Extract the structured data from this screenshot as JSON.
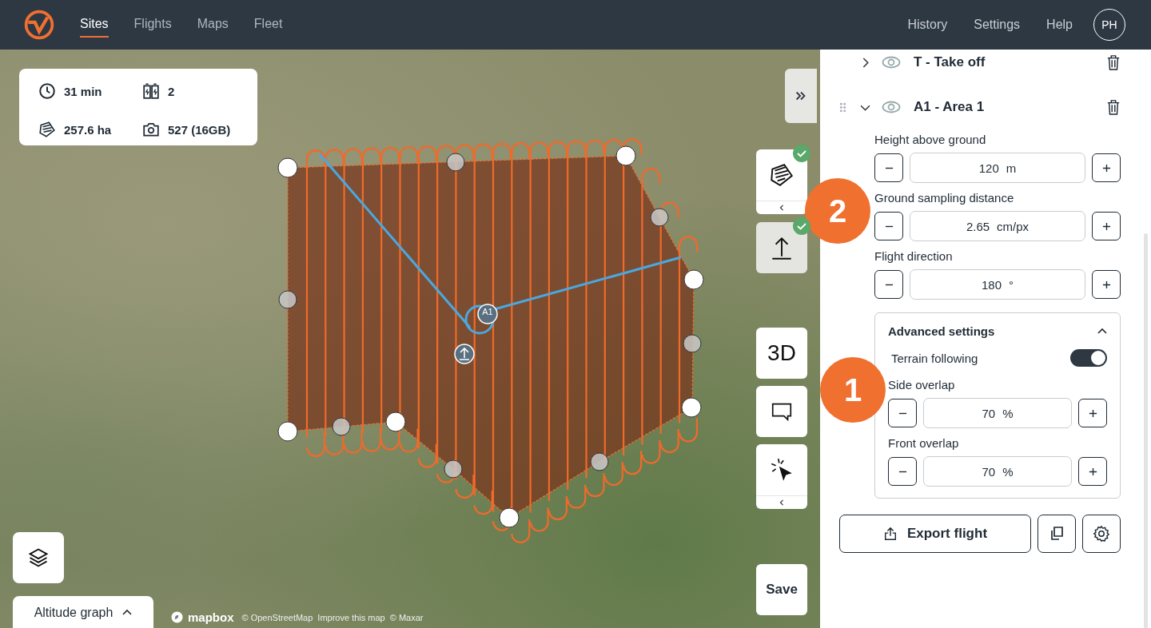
{
  "header": {
    "nav": [
      {
        "label": "Sites",
        "selected": true
      },
      {
        "label": "Flights",
        "selected": false
      },
      {
        "label": "Maps",
        "selected": false
      },
      {
        "label": "Fleet",
        "selected": false
      }
    ],
    "links": [
      "History",
      "Settings",
      "Help"
    ],
    "avatar": "PH"
  },
  "stats": [
    {
      "kind": "time",
      "text": "31 min"
    },
    {
      "kind": "battery",
      "text": "2"
    },
    {
      "kind": "area",
      "text": "257.6 ha"
    },
    {
      "kind": "photos",
      "text": "527 (16GB)"
    }
  ],
  "map": {
    "area_marker": "A1",
    "attribution": [
      "© OpenStreetMap",
      "Improve this map",
      "© Maxar"
    ],
    "logo": "mapbox"
  },
  "plan_tools": [
    {
      "kind": "area",
      "done": true,
      "disabled": false,
      "expander": true
    },
    {
      "kind": "takeoff",
      "done": true,
      "disabled": true,
      "expander": false
    }
  ],
  "view_tools": [
    {
      "kind": "label",
      "text": "3D",
      "expander": false
    },
    {
      "kind": "comment",
      "expander": false
    },
    {
      "kind": "select",
      "expander": true
    }
  ],
  "save_button": "Save",
  "altitude_graph": {
    "label": "Altitude graph",
    "expanded": false
  },
  "sidebar": {
    "items": [
      {
        "label": "T - Take off",
        "expanded": false
      },
      {
        "label": "A1 - Area 1",
        "expanded": true,
        "fields": [
          {
            "label": "Height above ground",
            "value": "120",
            "unit": "m"
          },
          {
            "label": "Ground sampling distance",
            "value": "2.65",
            "unit": "cm/px"
          },
          {
            "label": "Flight direction",
            "value": "180",
            "unit": "°"
          }
        ],
        "advanced": {
          "title": "Advanced settings",
          "expanded": true,
          "toggle": {
            "label": "Terrain following",
            "on": true
          },
          "fields": [
            {
              "label": "Side overlap",
              "value": "70",
              "unit": "%"
            },
            {
              "label": "Front overlap",
              "value": "70",
              "unit": "%"
            }
          ]
        }
      }
    ],
    "export_button": "Export flight"
  },
  "callouts": [
    {
      "label": "2"
    },
    {
      "label": "1"
    }
  ]
}
